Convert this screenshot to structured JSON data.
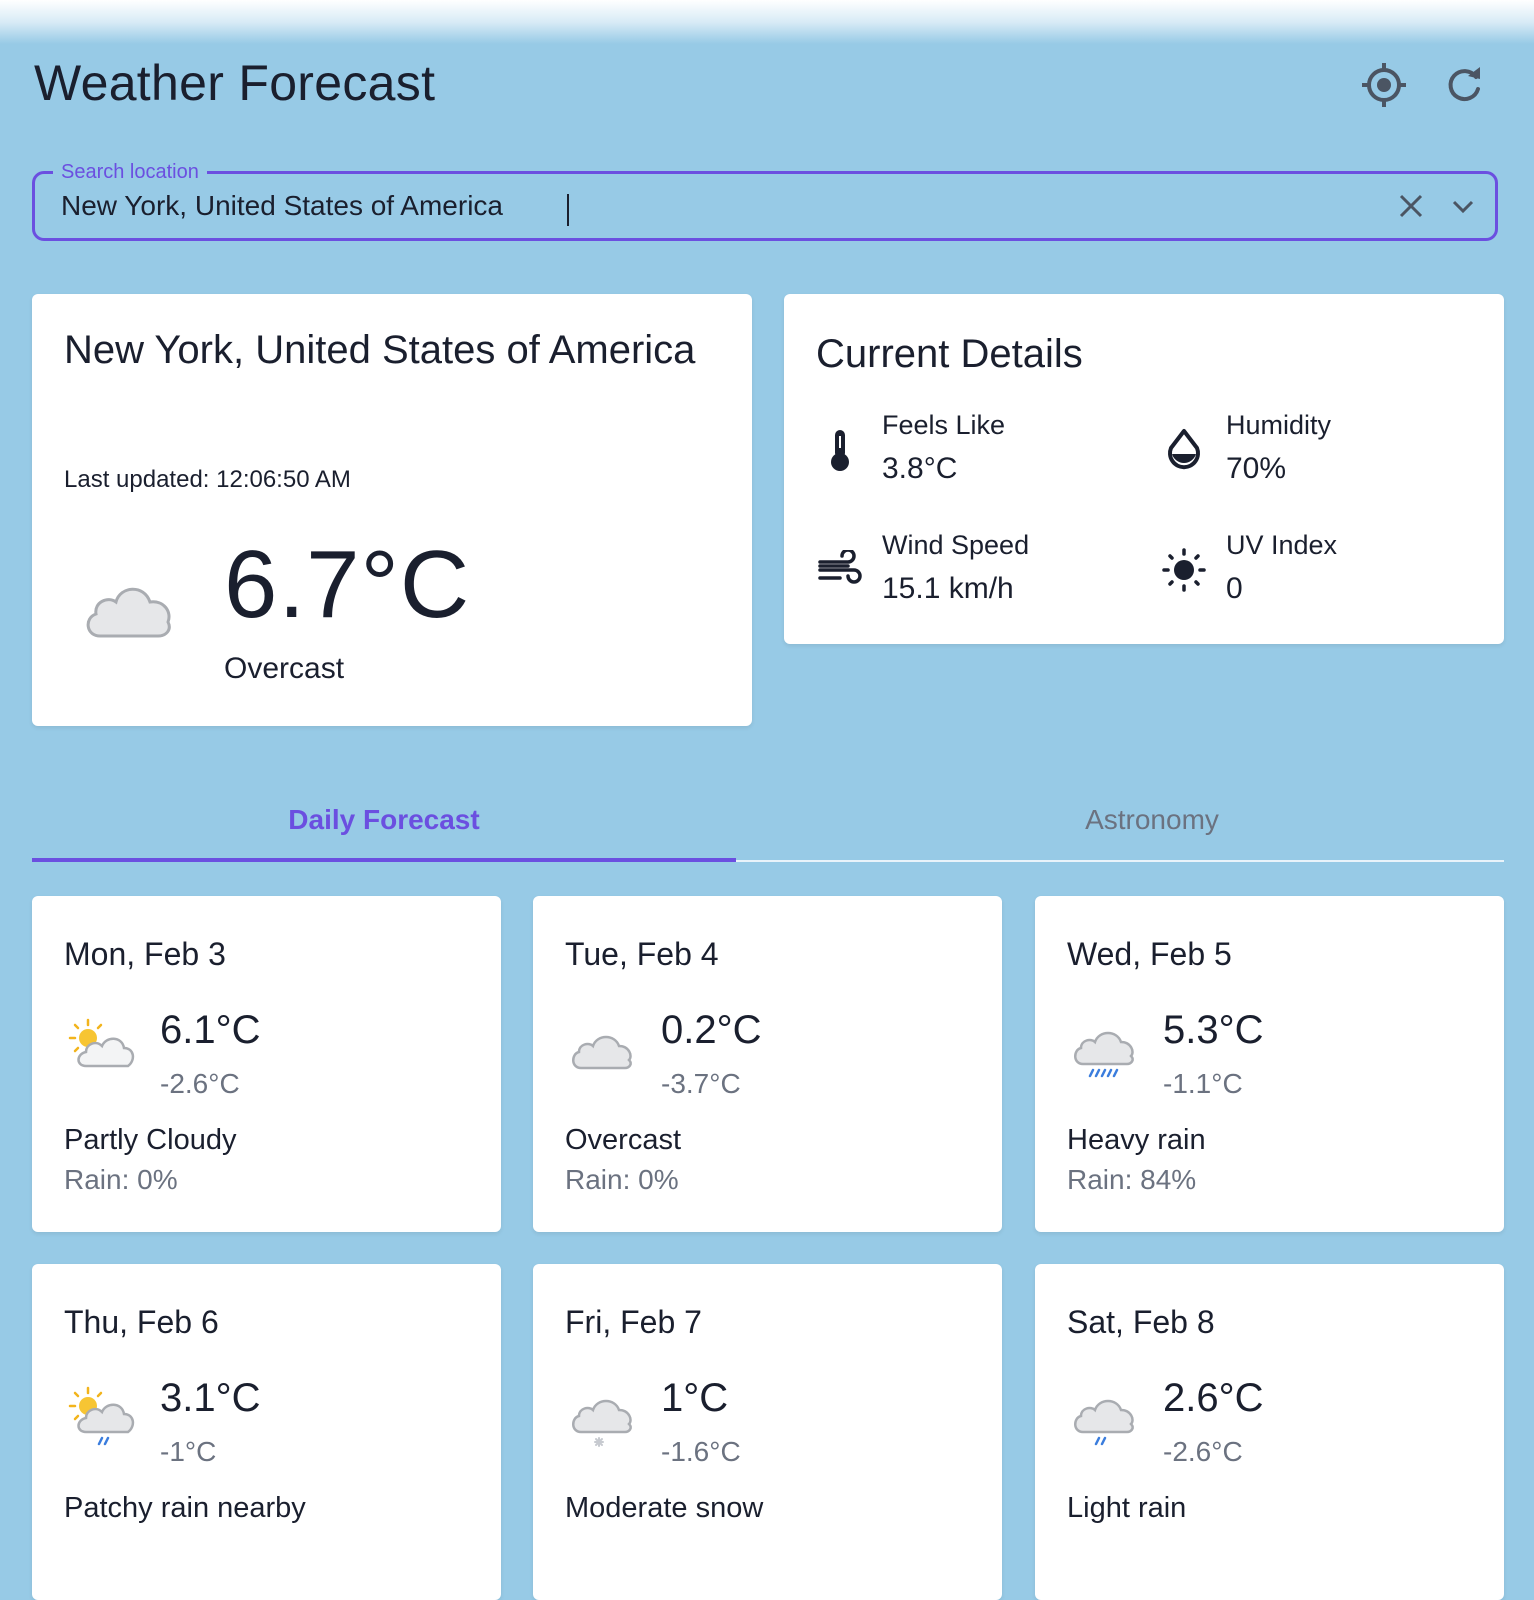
{
  "app": {
    "title": "Weather Forecast",
    "locate_icon": "my-location-icon",
    "refresh_icon": "refresh-icon"
  },
  "search": {
    "label": "Search location",
    "value": "New York, United States of America",
    "clear_icon": "close-icon",
    "dropdown_icon": "chevron-down-icon"
  },
  "current": {
    "location": "New York, United States of America",
    "last_updated": "Last updated: 12:06:50 AM",
    "temperature": "6.7°C",
    "condition": "Overcast",
    "icon": "overcast-cloud-icon"
  },
  "details": {
    "title": "Current Details",
    "items": [
      {
        "label": "Feels Like",
        "value": "3.8°C",
        "icon": "thermometer-icon"
      },
      {
        "label": "Humidity",
        "value": "70%",
        "icon": "water-drop-icon"
      },
      {
        "label": "Wind Speed",
        "value": "15.1 km/h",
        "icon": "wind-icon"
      },
      {
        "label": "UV Index",
        "value": "0",
        "icon": "sun-icon"
      }
    ]
  },
  "tabs": [
    {
      "label": "Daily Forecast",
      "active": true
    },
    {
      "label": "Astronomy",
      "active": false
    }
  ],
  "forecast": [
    {
      "date": "Mon, Feb 3",
      "max": "6.1°C",
      "min": "-2.6°C",
      "condition": "Partly Cloudy",
      "rain": "Rain: 0%",
      "icon": "partly-cloudy-icon"
    },
    {
      "date": "Tue, Feb 4",
      "max": "0.2°C",
      "min": "-3.7°C",
      "condition": "Overcast",
      "rain": "Rain: 0%",
      "icon": "overcast-cloud-icon"
    },
    {
      "date": "Wed, Feb 5",
      "max": "5.3°C",
      "min": "-1.1°C",
      "condition": "Heavy rain",
      "rain": "Rain: 84%",
      "icon": "heavy-rain-icon"
    },
    {
      "date": "Thu, Feb 6",
      "max": "3.1°C",
      "min": "-1°C",
      "condition": "Patchy rain nearby",
      "icon": "sun-cloud-rain-icon"
    },
    {
      "date": "Fri, Feb 7",
      "max": "1°C",
      "min": "-1.6°C",
      "condition": "Moderate snow",
      "icon": "snow-cloud-icon"
    },
    {
      "date": "Sat, Feb 8",
      "max": "2.6°C",
      "min": "-2.6°C",
      "condition": "Light rain",
      "icon": "light-rain-icon"
    }
  ],
  "colors": {
    "background": "#97cae6",
    "accent": "#6b4fe0",
    "text": "#1a1f2e",
    "muted": "#6b7280",
    "card": "#ffffff",
    "rain": "#3b7ddd"
  }
}
